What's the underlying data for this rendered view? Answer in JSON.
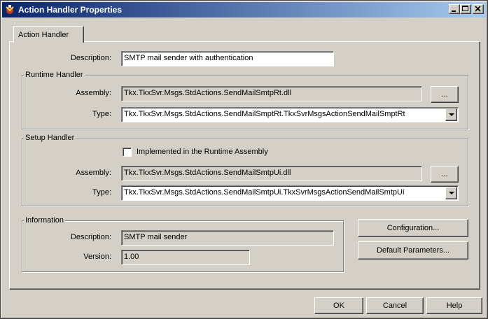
{
  "window": {
    "title": "Action Handler Properties",
    "minimize_icon": "minimize-icon",
    "maximize_icon": "maximize-icon",
    "close_icon": "close-icon"
  },
  "tabs": [
    {
      "label": "Action Handler"
    }
  ],
  "description": {
    "label": "Description:",
    "value": "SMTP mail sender with authentication"
  },
  "runtime": {
    "title": "Runtime Handler",
    "assembly_label": "Assembly:",
    "assembly_value": "Tkx.TkxSvr.Msgs.StdActions.SendMailSmtpRt.dll",
    "browse_label": "...",
    "type_label": "Type:",
    "type_value": "Tkx.TkxSvr.Msgs.StdActions.SendMailSmptRt.TkxSvrMsgsActionSendMailSmptRt"
  },
  "setup": {
    "title": "Setup Handler",
    "checkbox_label": "Implemented in the Runtime Assembly",
    "checkbox_checked": false,
    "assembly_label": "Assembly:",
    "assembly_value": "Tkx.TkxSvr.Msgs.StdActions.SendMailSmtpUi.dll",
    "browse_label": "...",
    "type_label": "Type:",
    "type_value": "Tkx.TkxSvr.Msgs.StdActions.SendMailSmtpUi.TkxSvrMsgsActionSendMailSmtpUi"
  },
  "information": {
    "title": "Information",
    "description_label": "Description:",
    "description_value": "SMTP mail sender",
    "version_label": "Version:",
    "version_value": "1.00"
  },
  "buttons": {
    "configuration": "Configuration...",
    "default_parameters": "Default Parameters...",
    "ok": "OK",
    "cancel": "Cancel",
    "help": "Help"
  },
  "colors": {
    "titlebar_start": "#0a246a",
    "titlebar_end": "#a6caf0",
    "face": "#d4d0c8"
  }
}
